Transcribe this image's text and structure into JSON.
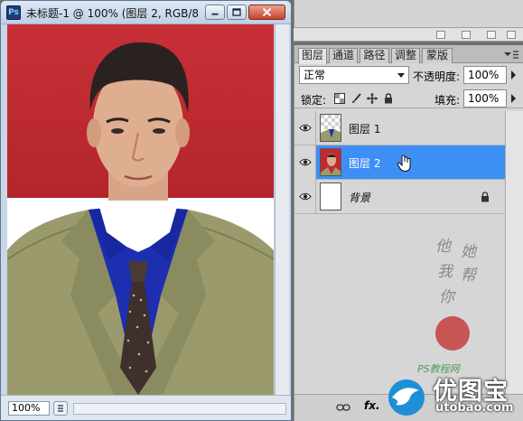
{
  "document": {
    "app_badge": "Ps",
    "title": "未标题-1 @ 100% (图层 2, RGB/8...",
    "zoom": "100%"
  },
  "layers_panel": {
    "tabs": [
      {
        "label": "图层",
        "active": true
      },
      {
        "label": "通道",
        "active": false
      },
      {
        "label": "路径",
        "active": false
      },
      {
        "label": "调整",
        "active": false
      },
      {
        "label": "蒙版",
        "active": false
      }
    ],
    "blend_mode": "正常",
    "opacity_label": "不透明度:",
    "opacity_value": "100%",
    "lock_label": "锁定:",
    "fill_label": "填充:",
    "fill_value": "100%",
    "layers": [
      {
        "name": "图层 1",
        "visible": true,
        "selected": false
      },
      {
        "name": "图层 2",
        "visible": true,
        "selected": true
      },
      {
        "name": "背景",
        "visible": true,
        "selected": false,
        "locked": true
      }
    ],
    "footer_fx": "fx."
  },
  "watermark": {
    "calligraphy_chars": [
      "他",
      "她",
      "我",
      "帮",
      "你"
    ],
    "signature": "PS教程网",
    "brand": "优图宝",
    "domain": "utobao.com"
  },
  "colors": {
    "selection_blue": "#3d8ff5",
    "photo_red_bg": "#c12a32",
    "shirt_blue": "#1d2fb0",
    "suit_khaki": "#9a9a6c"
  }
}
